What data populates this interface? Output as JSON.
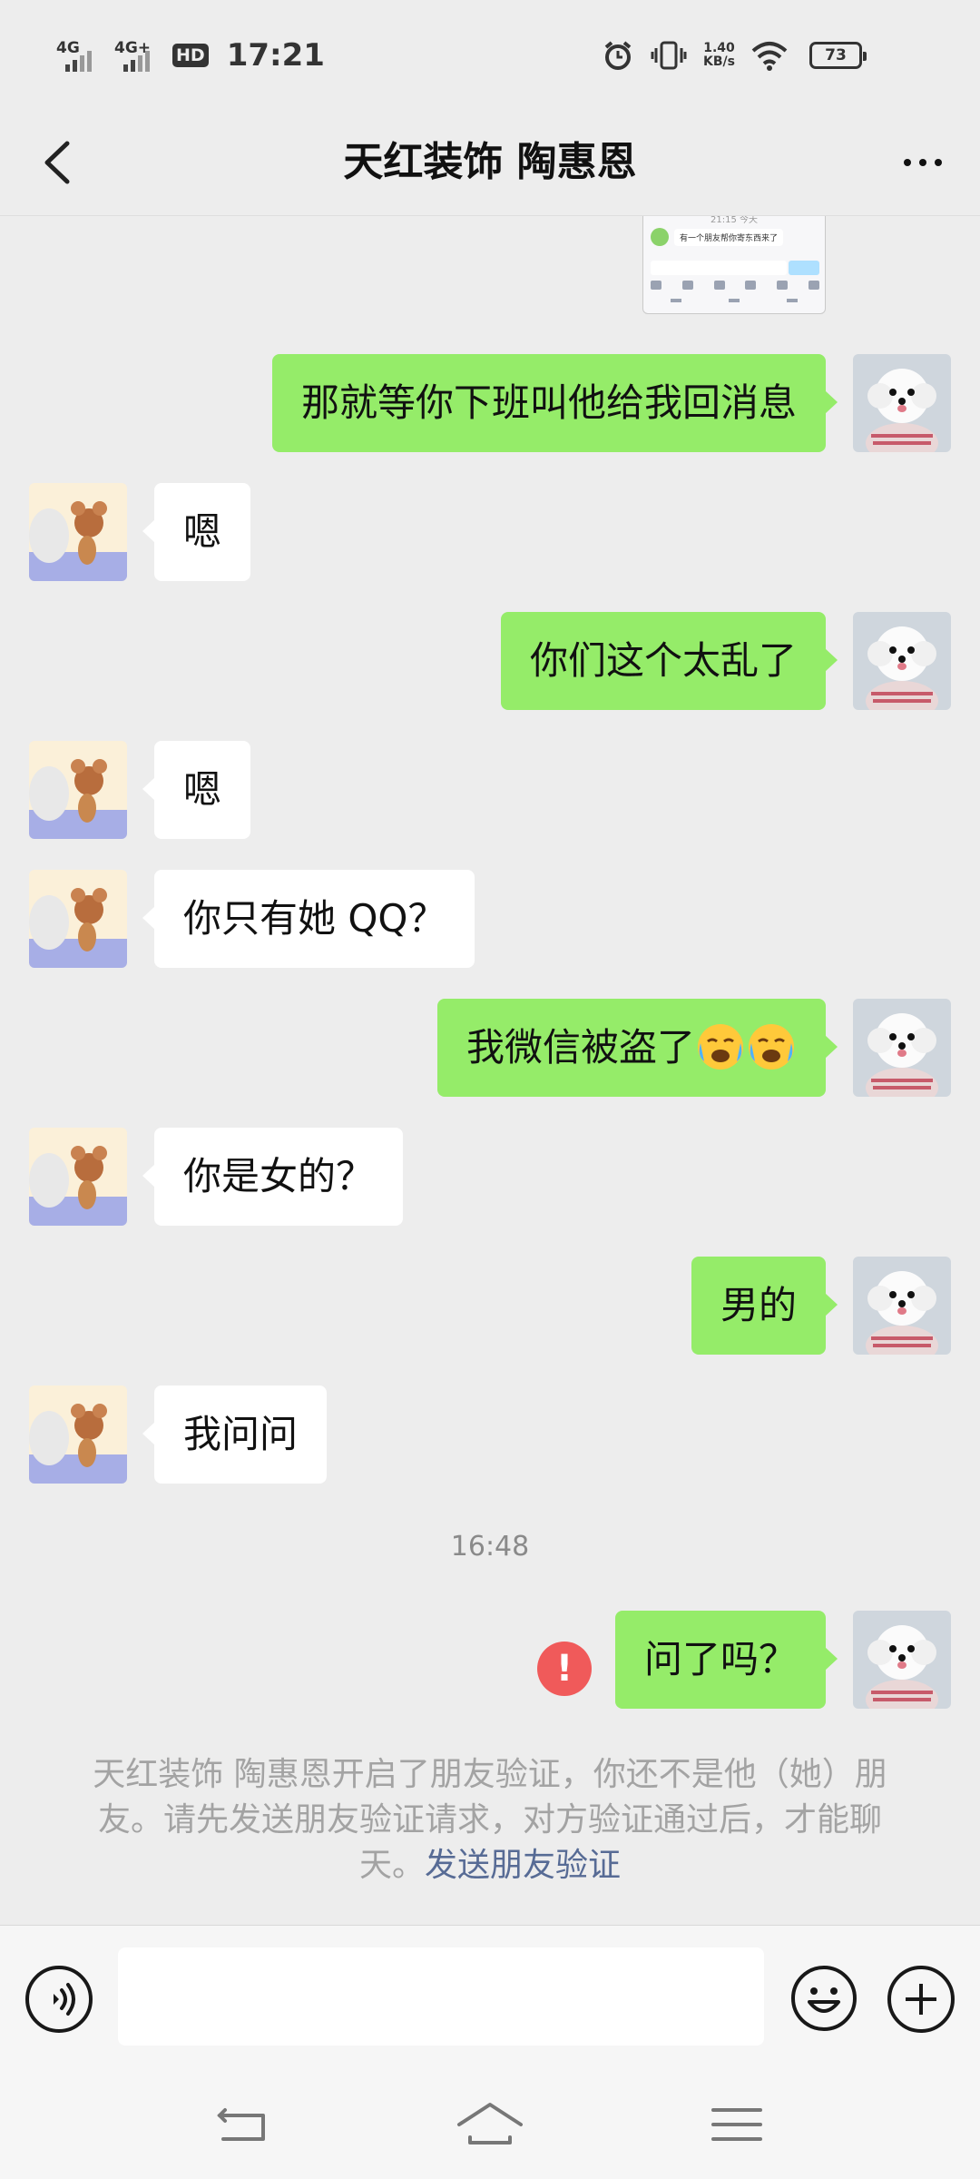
{
  "status_bar": {
    "network_1": "4G",
    "network_2": "4G+",
    "hd_badge": "HD",
    "time": "17:21",
    "speed_value": "1.40",
    "speed_unit": "KB/s",
    "battery": "73"
  },
  "header": {
    "title": "天红装饰 陶惠恩",
    "back_icon": "chevron-left-icon",
    "more_icon": "more-dots-icon"
  },
  "image_message": {
    "line_title": "21:15 今天",
    "line_text": "有一个朋友帮你寄东西来了"
  },
  "messages": [
    {
      "side": "me",
      "text": "那就等你下班叫他给我回消息"
    },
    {
      "side": "them",
      "text": "嗯"
    },
    {
      "side": "me",
      "text": "你们这个太乱了"
    },
    {
      "side": "them",
      "text": "嗯"
    },
    {
      "side": "them",
      "text": "你只有她 QQ？"
    },
    {
      "side": "me",
      "text": "我微信被盗了",
      "emoji": "loudly-crying-face x2"
    },
    {
      "side": "them",
      "text": "你是女的？"
    },
    {
      "side": "me",
      "text": "男的"
    },
    {
      "side": "them",
      "text": "我问问"
    },
    {
      "side": "me",
      "text": "问了吗？",
      "status": "send-failed"
    }
  ],
  "timestamp": "16:48",
  "system_notice": {
    "text": "天红装饰 陶惠恩开启了朋友验证，你还不是他（她）朋友。请先发送朋友验证请求，对方验证通过后，才能聊天。",
    "link": "发送朋友验证"
  },
  "failed_mark": "!",
  "input_bar": {
    "placeholder": "",
    "voice_icon": "voice-icon",
    "emoji_icon": "emoji-face-icon",
    "plus_icon": "plus-icon"
  },
  "system_nav": {
    "back_icon": "nav-back-icon",
    "home_icon": "nav-home-icon",
    "menu_icon": "nav-menu-icon"
  },
  "colors": {
    "background": "#ededed",
    "my_bubble": "#95ec69",
    "their_bubble": "#ffffff",
    "link": "#576b95",
    "fail": "#f05a5a"
  }
}
